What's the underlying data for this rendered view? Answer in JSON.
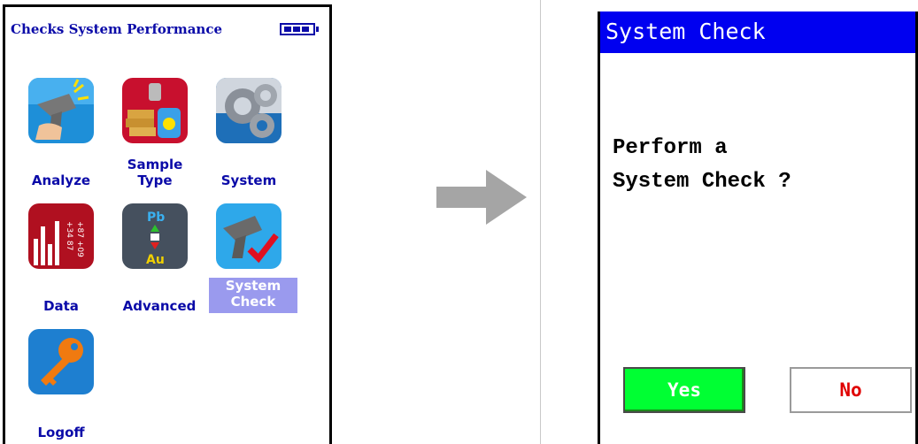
{
  "left_screen": {
    "title": "Checks System Performance",
    "battery_icon": "battery-icon",
    "apps": [
      {
        "label": "Analyze",
        "icon": "analyzer-gun-icon"
      },
      {
        "label": "Sample\nType",
        "icon": "sample-type-icon"
      },
      {
        "label": "System",
        "icon": "gears-icon"
      },
      {
        "label": "Data",
        "icon": "data-chart-icon"
      },
      {
        "label": "Advanced",
        "icon": "pb-au-icon"
      },
      {
        "label": "System\nCheck",
        "icon": "system-check-icon",
        "selected": true
      },
      {
        "label": "Logoff",
        "icon": "key-icon"
      }
    ]
  },
  "arrow": {
    "icon": "right-arrow-icon",
    "color": "#a5a5a5"
  },
  "dialog": {
    "title": "System Check",
    "message": "Perform a\nSystem Check ?",
    "yes_label": "Yes",
    "no_label": "No",
    "colors": {
      "title_bar": "#0000f0",
      "yes_bg": "#00ff33",
      "no_text": "#e00000"
    }
  }
}
